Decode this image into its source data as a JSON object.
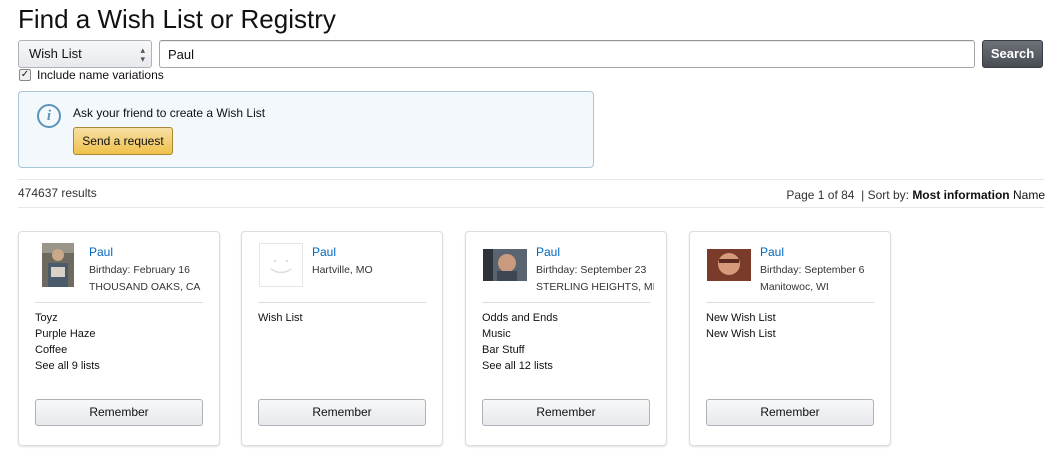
{
  "page": {
    "title": "Find a Wish List or Registry"
  },
  "search": {
    "type_selected": "Wish List",
    "query": "Paul",
    "button_label": "Search",
    "variations_label": "Include name variations",
    "variations_checked": true
  },
  "info": {
    "text": "Ask your friend to create a Wish List",
    "button_label": "Send a request"
  },
  "results": {
    "count_text": "474637 results",
    "page_text": "Page 1 of 84",
    "sort_label": "| Sort by:",
    "sort_active": "Most information",
    "sort_other": "Name"
  },
  "cards": [
    {
      "name": "Paul",
      "line2": "Birthday: February 16",
      "line3": "THOUSAND OAKS, CA",
      "lists": [
        "Toyz",
        "Purple Haze",
        "Coffee",
        "See all 9 lists"
      ],
      "button_label": "Remember"
    },
    {
      "name": "Paul",
      "line2": "Hartville, MO",
      "line3": "",
      "lists": [
        "Wish List"
      ],
      "button_label": "Remember"
    },
    {
      "name": "Paul",
      "line2": "Birthday: September 23",
      "line3": "STERLING HEIGHTS, MI",
      "lists": [
        "Odds and Ends",
        "Music",
        "Bar Stuff",
        "See all 12 lists"
      ],
      "button_label": "Remember"
    },
    {
      "name": "Paul",
      "line2": "Birthday: September 6",
      "line3": "Manitowoc, WI",
      "lists": [
        "New Wish List",
        "New Wish List"
      ],
      "button_label": "Remember"
    }
  ],
  "colors": {
    "link": "#0066c0",
    "info_border": "#a9c5d8",
    "info_bg": "#f2f8fb",
    "send_button": "#f0c14b",
    "search_button": "#494d53"
  }
}
